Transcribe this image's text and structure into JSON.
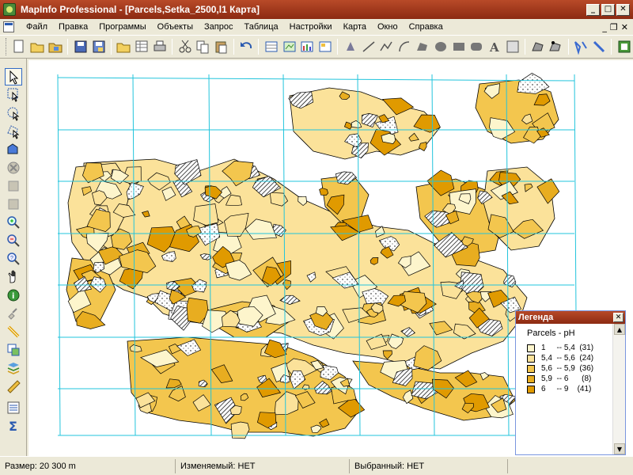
{
  "window": {
    "title": "MapInfo Professional - [Parcels,Setka_2500,l1 Карта]"
  },
  "menu": [
    {
      "label": "Файл",
      "name": "file"
    },
    {
      "label": "Правка",
      "name": "edit"
    },
    {
      "label": "Программы",
      "name": "programs"
    },
    {
      "label": "Объекты",
      "name": "objects"
    },
    {
      "label": "Запрос",
      "name": "query"
    },
    {
      "label": "Таблица",
      "name": "table"
    },
    {
      "label": "Настройки",
      "name": "options"
    },
    {
      "label": "Карта",
      "name": "map"
    },
    {
      "label": "Окно",
      "name": "window"
    },
    {
      "label": "Справка",
      "name": "help"
    }
  ],
  "colors": {
    "grid": "#22c4dc",
    "class1": "#fdf5cc",
    "class2": "#fbe29a",
    "class3": "#f3c64e",
    "class4": "#e8ad20",
    "class5": "#e09a00",
    "outline": "#000000"
  },
  "legend": {
    "window_title": "Легенда",
    "heading": "Parcels - pH",
    "rows": [
      {
        "text": "1     -- 5,4  (31)"
      },
      {
        "text": "5,4  -- 5,6  (24)"
      },
      {
        "text": "5,6  -- 5,9  (36)"
      },
      {
        "text": "5,9  -- 6      (8)"
      },
      {
        "text": "6     -- 9    (41)"
      }
    ]
  },
  "status": {
    "size": "Размер: 20 300 m",
    "editable": "Изменяемый: НЕТ",
    "selected": "Выбранный: НЕТ"
  },
  "toolbar_icons": [
    "new-icon",
    "open-icon",
    "open-workspace-icon",
    "save-icon",
    "save-copy-icon",
    "open-dbms-icon",
    "new-browser-icon",
    "print-icon",
    "cut-icon",
    "copy-icon",
    "paste-icon",
    "undo-icon",
    "new-browser-window-icon",
    "new-map-window-icon",
    "new-graph-window-icon",
    "new-layout-window-icon",
    "symbol-icon",
    "line-icon",
    "polyline-icon",
    "arc-icon",
    "polygon-icon",
    "ellipse-icon",
    "rectangle-icon",
    "rounded-rectangle-icon",
    "text-icon",
    "frame-icon",
    "reshape-icon",
    "add-node-icon",
    "symbol-style-icon",
    "line-style-icon",
    "help-icon"
  ],
  "left_tools": [
    "select-icon",
    "marquee-select-icon",
    "radius-select-icon",
    "polygon-select-icon",
    "boundary-select-icon",
    "invert-selection-icon",
    "graph-select-icon",
    "layer-control-icon",
    "zoom-in-icon",
    "zoom-out-icon",
    "change-view-icon",
    "grabber-icon",
    "info-icon",
    "label-icon",
    "drag-window-icon",
    "ruler-icon",
    "legend-icon",
    "statistics-icon"
  ]
}
